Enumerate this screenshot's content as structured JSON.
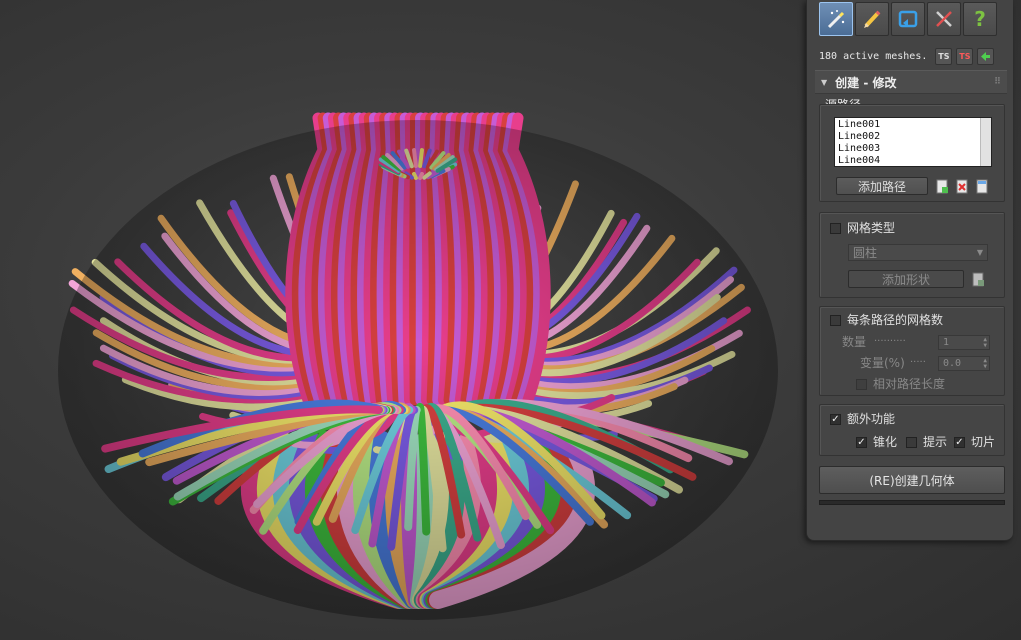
{
  "colors": {
    "tube_palette": [
      "#e83e8c",
      "#f4e86a",
      "#6fd1e0",
      "#7b5ce6",
      "#3fbf3f",
      "#d84040",
      "#f2a5d8",
      "#b8e986",
      "#4a7de0",
      "#f0b060",
      "#c65cd6",
      "#9fe0c0",
      "#e5e5a0",
      "#3cae8e",
      "#ff8fb3"
    ],
    "panel_bg": "#444444"
  },
  "toolbar": {
    "tabs": [
      {
        "name": "create-tab",
        "icon": "magic-wand-icon",
        "active": true
      },
      {
        "name": "modify-tab",
        "icon": "pencil-icon",
        "active": false
      },
      {
        "name": "hierarchy-tab",
        "icon": "return-arrow-icon",
        "active": false
      },
      {
        "name": "utilities-tab",
        "icon": "tools-icon",
        "active": false
      },
      {
        "name": "help-tab",
        "icon": "question-icon",
        "glyph": "?",
        "active": false
      }
    ],
    "status_text": "180 active meshes.",
    "mini_buttons": [
      {
        "icon": "ts-select-icon",
        "label": "TS"
      },
      {
        "icon": "ts-delete-icon",
        "label": "TS"
      },
      {
        "icon": "green-arrow-icon",
        "label": ""
      }
    ]
  },
  "rollout": {
    "title": "创建 - 修改",
    "source_paths": {
      "title": "源路径",
      "items": [
        "Line001",
        "Line002",
        "Line003",
        "Line004"
      ],
      "add_button": "添加路径"
    },
    "mesh_type": {
      "checkbox_label": "网格类型",
      "checked": false,
      "dropdown_value": "圆柱",
      "add_shape_button": "添加形状"
    },
    "mesh_per_path": {
      "checkbox_label": "每条路径的网格数",
      "checked": false,
      "count_label": "数量",
      "count_dots": "..........",
      "count_value": "1",
      "variation_label": "变量(%)",
      "variation_dots": ".....",
      "variation_value": "0.0",
      "relative_length_label": "相对路径长度"
    },
    "extras": {
      "checkbox_label": "额外功能",
      "checked": true,
      "taper_label": "锥化",
      "taper_checked": true,
      "hint_label": "提示",
      "hint_checked": false,
      "slice_label": "切片",
      "slice_checked": true
    },
    "rebuild_button": "(RE)创建几何体"
  },
  "progress": {
    "value": 0
  }
}
